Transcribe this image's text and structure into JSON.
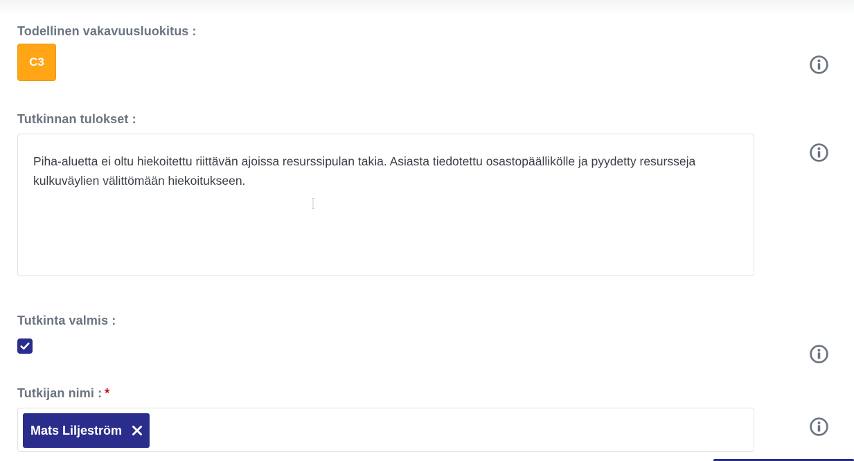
{
  "fields": {
    "severity": {
      "label": "Todellinen vakavuusluokitus :",
      "value": "C3",
      "badge_color": "#ffa516"
    },
    "results": {
      "label": "Tutkinnan tulokset :",
      "value": "Piha-aluetta ei oltu hiekoitettu riittävän ajoissa resurssipulan takia. Asiasta tiedotettu osastopäällikölle ja pyydetty resursseja kulkuväylien välittömään hiekoitukseen."
    },
    "complete": {
      "label": "Tutkinta valmis :",
      "checked": true
    },
    "investigator": {
      "label": "Tutkijan nimi :",
      "required_marker": "*",
      "selected": [
        "Mats Liljeström"
      ]
    }
  },
  "icons": {
    "info": "info-circle-icon",
    "check": "check-icon",
    "remove": "close-icon"
  },
  "colors": {
    "accent": "#2b2d8c",
    "label": "#6b7480",
    "required": "#d0021b",
    "info_icon": "#6b7480"
  }
}
